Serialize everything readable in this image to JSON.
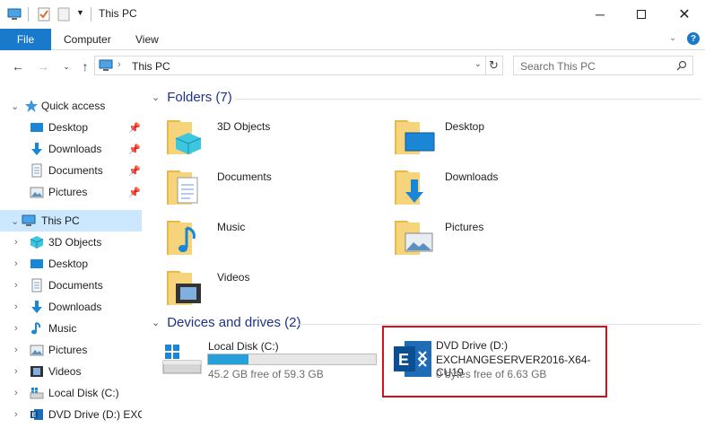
{
  "window": {
    "title": "This PC"
  },
  "ribbon": {
    "file": "File",
    "computer": "Computer",
    "view": "View"
  },
  "address": {
    "path": "This PC",
    "search_placeholder": "Search This PC"
  },
  "nav": {
    "quick_access": "Quick access",
    "quick_items": [
      "Desktop",
      "Downloads",
      "Documents",
      "Pictures"
    ],
    "this_pc": "This PC",
    "pc_items": [
      "3D Objects",
      "Desktop",
      "Documents",
      "Downloads",
      "Music",
      "Pictures",
      "Videos",
      "Local Disk (C:)",
      "DVD Drive (D:) EXCH"
    ]
  },
  "content": {
    "folders_header": "Folders (7)",
    "folders": [
      "3D Objects",
      "Desktop",
      "Documents",
      "Downloads",
      "Music",
      "Pictures",
      "Videos"
    ],
    "devices_header": "Devices and drives (2)",
    "drives": [
      {
        "name": "Local Disk (C:)",
        "free": "45.2 GB free of 59.3 GB",
        "used_fraction": 0.24
      },
      {
        "name": "DVD Drive (D:)",
        "label": "EXCHANGESERVER2016-X64-CU19",
        "free": "0 bytes free of 6.63 GB"
      }
    ]
  },
  "colors": {
    "accent": "#1979ca",
    "selected": "#cce8ff",
    "header": "#1e3287",
    "highlight_box": "#d0101e",
    "bar_fill": "#26a0da"
  }
}
